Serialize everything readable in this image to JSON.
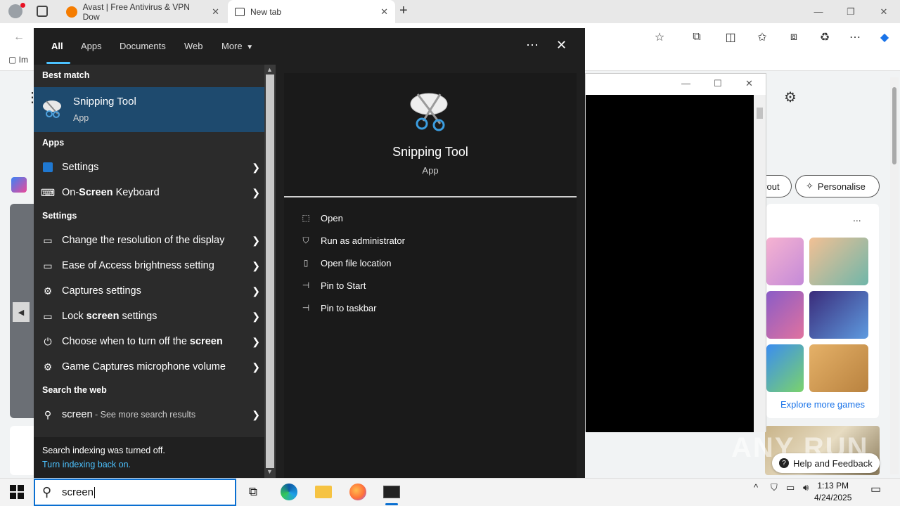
{
  "browser": {
    "tabs": [
      {
        "title": "Avast | Free Antivirus & VPN Dow",
        "icon": "avast-icon"
      },
      {
        "title": "New tab",
        "icon": "newtab-icon"
      }
    ],
    "favorites_item": "Im",
    "help_feedback": "Help and Feedback",
    "personalise": "Personalise",
    "layout_pill": "yout",
    "explore_games": "Explore more games",
    "more_dots": "...",
    "watermark": "ANY RUN"
  },
  "search_panel": {
    "tabs": [
      "All",
      "Apps",
      "Documents",
      "Web",
      "More"
    ],
    "best_match_heading": "Best match",
    "best_match": {
      "name": "Snipping Tool",
      "type": "App"
    },
    "apps_heading": "Apps",
    "apps": [
      {
        "pre": "Settings",
        "bold": "",
        "post": ""
      },
      {
        "pre": "On-",
        "bold": "Screen",
        "post": " Keyboard"
      }
    ],
    "settings_heading": "Settings",
    "settings": [
      {
        "pre": "Change the resolution of the display",
        "bold": "",
        "post": ""
      },
      {
        "pre": "Ease of Access brightness setting",
        "bold": "",
        "post": ""
      },
      {
        "pre": "Captures settings",
        "bold": "",
        "post": ""
      },
      {
        "pre": "Lock ",
        "bold": "screen",
        "post": " settings"
      },
      {
        "pre": "Choose when to turn off the ",
        "bold": "screen",
        "post": ""
      },
      {
        "pre": "Game Captures microphone volume",
        "bold": "",
        "post": ""
      }
    ],
    "web_heading": "Search the web",
    "web_query": "screen",
    "web_suffix": " - See more search results",
    "footer_line1": "Search indexing was turned off.",
    "footer_link": "Turn indexing back on.",
    "detail": {
      "title": "Snipping Tool",
      "subtitle": "App",
      "actions": [
        "Open",
        "Run as administrator",
        "Open file location",
        "Pin to Start",
        "Pin to taskbar"
      ]
    }
  },
  "taskbar": {
    "search_text": "screen",
    "time": "1:13 PM",
    "date": "4/24/2025"
  },
  "colors": {
    "accent": "#4cc2ff",
    "best_match_bg": "#1e4a6e",
    "panel_bg": "#2b2b2b"
  }
}
